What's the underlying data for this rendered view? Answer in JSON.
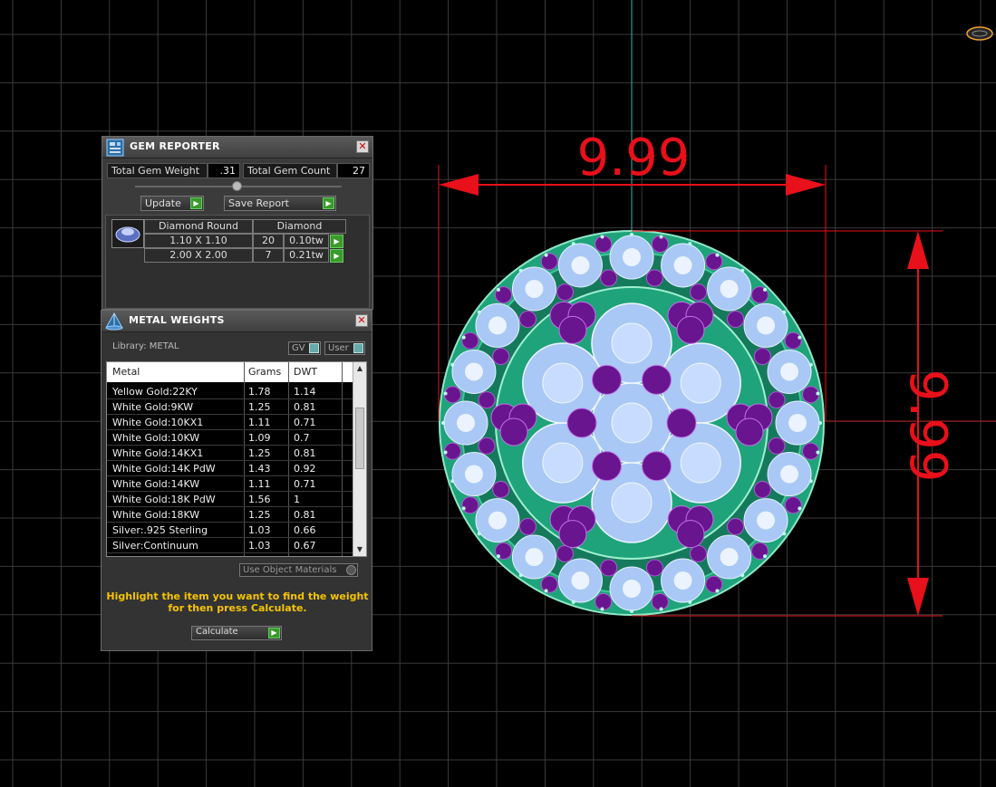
{
  "gem_reporter": {
    "title": "GEM REPORTER",
    "close_glyph": "✕",
    "total_weight_label": "Total Gem Weight",
    "total_weight_value": ".31",
    "total_count_label": "Total Gem Count",
    "total_count_value": "27",
    "update_label": "Update",
    "save_label": "Save Report",
    "table_header": {
      "shape": "Diamond Round",
      "material": "Diamond"
    },
    "rows": [
      {
        "size": "1.10 X 1.10",
        "count": "20",
        "weight": "0.10tw"
      },
      {
        "size": "2.00 X 2.00",
        "count": "7",
        "weight": "0.21tw"
      }
    ]
  },
  "metal_weights": {
    "title": "METAL WEIGHTS",
    "close_glyph": "✕",
    "library_label": "Library: METAL",
    "gv_label": "GV",
    "user_label": "User",
    "columns": {
      "metal": "Metal",
      "grams": "Grams",
      "dwt": "DWT"
    },
    "rows": [
      {
        "metal": "Yellow Gold:22KY",
        "grams": "1.78",
        "dwt": "1.14"
      },
      {
        "metal": "White Gold:9KW",
        "grams": "1.25",
        "dwt": "0.81"
      },
      {
        "metal": "White Gold:10KX1",
        "grams": "1.11",
        "dwt": "0.71"
      },
      {
        "metal": "White Gold:10KW",
        "grams": "1.09",
        "dwt": "0.7"
      },
      {
        "metal": "White Gold:14KX1",
        "grams": "1.25",
        "dwt": "0.81"
      },
      {
        "metal": "White Gold:14K PdW",
        "grams": "1.43",
        "dwt": "0.92"
      },
      {
        "metal": "White Gold:14KW",
        "grams": "1.11",
        "dwt": "0.71"
      },
      {
        "metal": "White Gold:18K PdW",
        "grams": "1.56",
        "dwt": "1"
      },
      {
        "metal": "White Gold:18KW",
        "grams": "1.25",
        "dwt": "0.81"
      },
      {
        "metal": "Silver:.925 Sterling",
        "grams": "1.03",
        "dwt": "0.66"
      },
      {
        "metal": "Silver:Continuum",
        "grams": "1.03",
        "dwt": "0.67"
      }
    ],
    "use_object_materials_label": "Use Object Materials",
    "hint_line1": "Highlight the item you want to find the weight",
    "hint_line2": "for then press Calculate.",
    "calculate_label": "Calculate"
  },
  "viewport": {
    "width_dimension": "9.99",
    "height_dimension": "9.99",
    "dimension_color": "#e8101a",
    "grid_color": "#3a3a3a",
    "gem_colors": {
      "metal": "#1fa37a",
      "diamond": "#a9c8f5",
      "amethyst": "#6a1590"
    }
  }
}
